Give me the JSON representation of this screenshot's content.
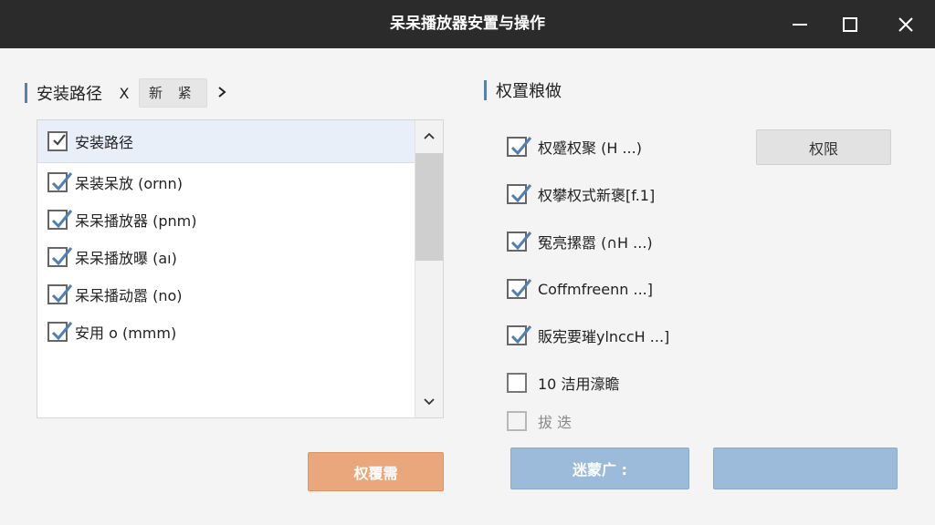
{
  "window": {
    "title": "呆呆播放器安置与操作",
    "controls": {
      "minimize": "minimize-icon",
      "maximize": "maximize-icon",
      "close": "close-icon"
    }
  },
  "left": {
    "section_title": "安装路径",
    "x_label": "X",
    "chip_label": "新 紧",
    "list": {
      "header": {
        "label": "安装路径",
        "checked": true
      },
      "items": [
        {
          "label": "呆装呆放 (ornn)",
          "checked": true
        },
        {
          "label": "呆呆播放器 (pnm)",
          "checked": true
        },
        {
          "label": "呆呆播放曝 (aı)",
          "checked": true
        },
        {
          "label": "呆呆播动嚣 (no)",
          "checked": true
        },
        {
          "label": "安用 o (mmm)",
          "checked": true
        }
      ]
    },
    "action_button": "权覆需"
  },
  "right": {
    "section_title": "权置粮做",
    "top_button": "权限",
    "options": [
      {
        "label": "权蹙权聚 (H ...)",
        "checked": true,
        "disabled": false
      },
      {
        "label": "权攀权式新褒[f.1]",
        "checked": true,
        "disabled": false
      },
      {
        "label": "冤亮摞嚣 (∩H ...)",
        "checked": true,
        "disabled": false
      },
      {
        "label": "Coffmfreenn ...]",
        "checked": true,
        "disabled": false
      },
      {
        "label": "販宪要璀ylnccH ...]",
        "checked": true,
        "disabled": false
      },
      {
        "label": "10 洁用濠瞻",
        "checked": false,
        "disabled": false
      },
      {
        "label": "拔 迭",
        "checked": false,
        "disabled": true
      }
    ],
    "buttons": {
      "primary": "迷蒙广 :",
      "secondary": ""
    }
  },
  "colors": {
    "titlebar": "#2b2b2b",
    "accent_bar": "#5a7fa8",
    "checkmark": "#4f7fb3",
    "orange_button": "#e9a77b",
    "blue_button": "#9cbad9",
    "list_header": "#e8eff8"
  }
}
